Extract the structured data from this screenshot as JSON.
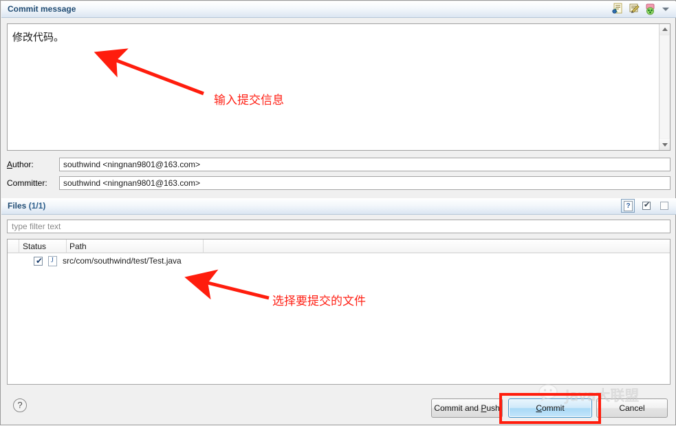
{
  "commit_message_section": {
    "title": "Commit message",
    "message_value": "修改代码。",
    "toolbar": [
      {
        "name": "insert-change-id-icon",
        "label": "Add Change-Id"
      },
      {
        "name": "insert-signed-off-icon",
        "label": "Add Signed-off-by"
      },
      {
        "name": "amend-commit-icon",
        "label": "Amend previous commit"
      },
      {
        "name": "chevron-down-icon",
        "label": "More"
      }
    ]
  },
  "author": {
    "label": "Author:",
    "label_mnemonic": "A",
    "label_rest": "uthor:",
    "value": "southwind <ningnan9801@163.com>"
  },
  "committer": {
    "label": "Committer:",
    "value": "southwind <ningnan9801@163.com>"
  },
  "files_section": {
    "title": "Files",
    "count": "(1/1)",
    "filter_placeholder": "type filter text",
    "toolbar": [
      {
        "name": "show-untracked-files-button",
        "label": "?"
      },
      {
        "name": "select-all-button",
        "label": "✔"
      },
      {
        "name": "deselect-all-button",
        "label": ""
      }
    ],
    "columns": [
      "Status",
      "Path"
    ],
    "rows": [
      {
        "checked": true,
        "file_type_letter": "J",
        "path": "src/com/southwind/test/Test.java"
      }
    ]
  },
  "footer": {
    "help_label": "?",
    "buttons": [
      {
        "name": "commit-and-push-button",
        "pre": "Commit and ",
        "mnemonic": "P",
        "post": "ush",
        "default": false
      },
      {
        "name": "commit-button",
        "pre": "",
        "mnemonic": "C",
        "post": "ommit",
        "default": true
      },
      {
        "name": "cancel-button",
        "pre": "Cancel",
        "mnemonic": "",
        "post": "",
        "default": false
      }
    ]
  },
  "annotations": [
    {
      "name": "annotation-enter-commit-message",
      "text": "输入提交信息"
    },
    {
      "name": "annotation-select-files-to-commit",
      "text": "选择要提交的文件"
    }
  ],
  "watermark": {
    "text": "Java大联盟"
  },
  "colors": {
    "annotation_red": "#ff2116",
    "highlight_red": "#ff1d0d",
    "header_text": "#1f4b73",
    "default_button_border": "#3c8fc6"
  }
}
